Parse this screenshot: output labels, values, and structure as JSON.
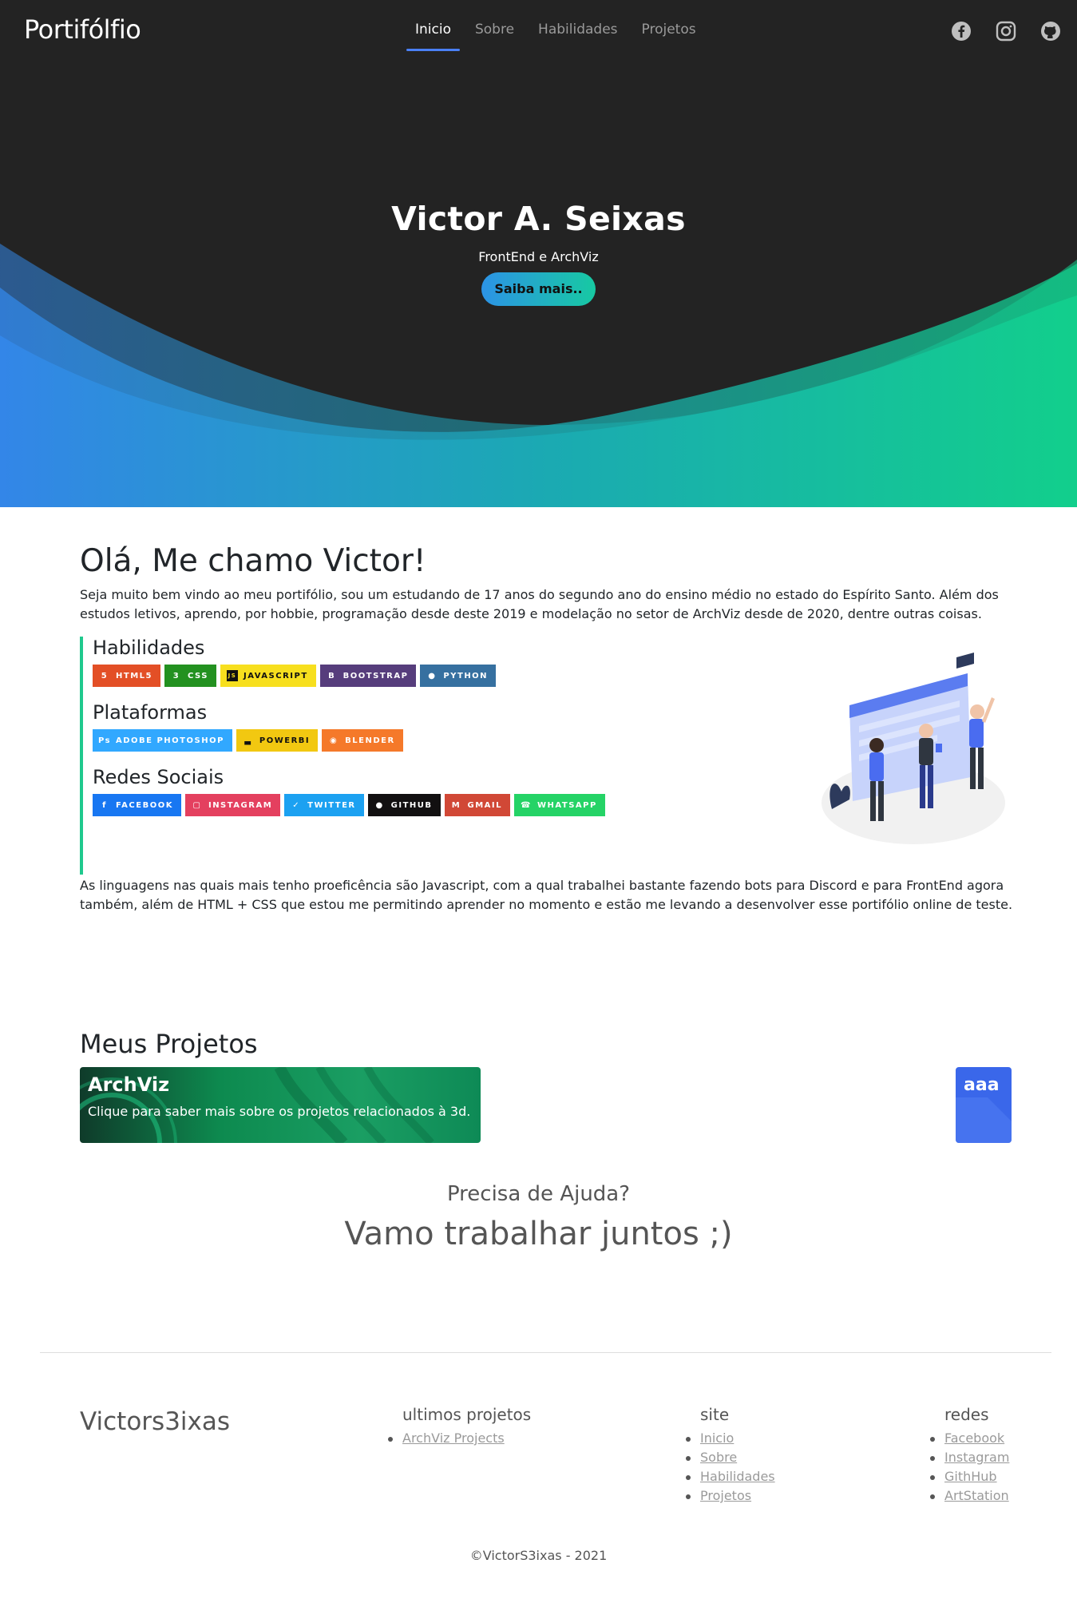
{
  "nav": {
    "brand": "Portifólfio",
    "links": [
      "Inicio",
      "Sobre",
      "Habilidades",
      "Projetos"
    ],
    "social_icons": [
      "facebook-icon",
      "instagram-icon",
      "github-icon"
    ]
  },
  "hero": {
    "name": "Victor A. Seixas",
    "subtitle": "FrontEnd e ArchViz",
    "button": "Saiba mais.."
  },
  "about": {
    "heading": "Olá, Me chamo Victor!",
    "intro": "Seja muito bem vindo ao meu portifólio, sou um estudando de 17 anos do segundo ano do ensino médio no estado do Espírito Santo. Além dos estudos letivos, aprendo, por hobbie, programação desde deste 2019 e modelação no setor de ArchViz desde de 2020, dentre outras coisas.",
    "groups": [
      {
        "title": "Habilidades",
        "badges": [
          {
            "label": "HTML5",
            "color": "#e34f26",
            "icon": "html5-icon"
          },
          {
            "label": "CSS",
            "color": "#239120",
            "icon": "css3-icon"
          },
          {
            "label": "JAVASCRIPT",
            "color": "#f7df1e",
            "icon": "javascript-icon"
          },
          {
            "label": "BOOTSTRAP",
            "color": "#563d7c",
            "icon": "bootstrap-icon"
          },
          {
            "label": "PYTHON",
            "color": "#3670a0",
            "icon": "python-icon"
          }
        ]
      },
      {
        "title": "Plataformas",
        "badges": [
          {
            "label": "ADOBE PHOTOSHOP",
            "color": "#31a8ff",
            "icon": "photoshop-icon"
          },
          {
            "label": "POWERBI",
            "color": "#f2c811",
            "icon": "powerbi-icon"
          },
          {
            "label": "BLENDER",
            "color": "#f5792a",
            "icon": "blender-icon"
          }
        ]
      },
      {
        "title": "Redes Sociais",
        "badges": [
          {
            "label": "FACEBOOK",
            "color": "#1877f2",
            "icon": "facebook-icon"
          },
          {
            "label": "INSTAGRAM",
            "color": "#e4405f",
            "icon": "instagram-icon"
          },
          {
            "label": "TWITTER",
            "color": "#1ca1f1",
            "icon": "twitter-icon"
          },
          {
            "label": "GITHUB",
            "color": "#121011",
            "icon": "github-icon"
          },
          {
            "label": "GMAIL",
            "color": "#d14836",
            "icon": "gmail-icon"
          },
          {
            "label": "WHATSAPP",
            "color": "#25d366",
            "icon": "whatsapp-icon"
          }
        ]
      }
    ],
    "outro": "As linguagens nas quais mais tenho proeficência são Javascript, com a qual trabalhei bastante fazendo bots para Discord e para FrontEnd agora também, além de HTML + CSS que estou me permitindo aprender no momento e estão me levando a desenvolver esse portifólio online de teste."
  },
  "projects": {
    "title": "Meus Projetos",
    "cards": [
      {
        "title": "ArchViz",
        "text": "Clique para saber mais sobre os projetos relacionados à 3d."
      },
      {
        "title": "aaa",
        "text": ""
      }
    ]
  },
  "help": {
    "line1": "Precisa de Ajuda?",
    "line2": "Vamo trabalhar juntos ;)"
  },
  "footer": {
    "brand": "Victors3ixas",
    "columns": [
      {
        "title": "ultimos projetos",
        "items": [
          "ArchViz Projects"
        ]
      },
      {
        "title": "site",
        "items": [
          "Inicio",
          "Sobre",
          "Habilidades",
          "Projetos"
        ]
      },
      {
        "title": "redes",
        "items": [
          "Facebook",
          "Instagram",
          "GithHub",
          "ArtStation"
        ]
      }
    ],
    "copyright": "©VictorS3ixas - 2021"
  },
  "colors": {
    "accent_blue": "#4a80f5",
    "gradient_start": "#2c93e6",
    "gradient_end": "#17c9a2",
    "hero_dark": "#232323"
  }
}
